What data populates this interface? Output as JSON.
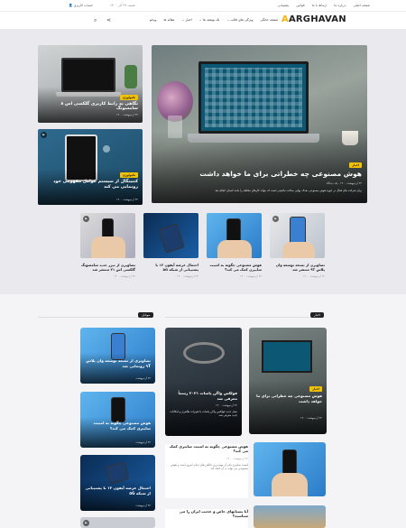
{
  "topbar": {
    "links": [
      "صفحه اصلی",
      "درباره ما",
      "ارتباط با ما",
      "قوانین",
      "پشتیبانی"
    ],
    "account": "حساب کاربری",
    "date": "شنبه، ۲۷ آذر ۱۴۰۰"
  },
  "nav": {
    "logo": "ARGHAVAN",
    "menu": [
      "صفحه خانگی",
      "ویژگی های قالب",
      "تک نوشته ها",
      "اخبار",
      "مقاله ها",
      "ویدئو"
    ]
  },
  "hero": {
    "badge": "اخبار",
    "title": "هوش مصنوعی چه خطراتی برای ما خواهد داشت",
    "meta": "۲۲ اردیبهشت ۱۴۰۰ - یک دیدگاه",
    "desc": "برای شرکت های فعال در حوزه هوش مصنوعی، هدف نهایی ساخت ماشینی است که بتواند کارهای مختلف را مانند انسان انجام دهد"
  },
  "side": [
    {
      "badge": "تکنولوژی",
      "title": "نگاهی به رابط کاربری گلکسی اس ۸ سامسونگ",
      "meta": "۲۲ اردیبهشت ۱۴۰۰"
    },
    {
      "badge": "تکنولوژی",
      "title": "کنتینگال از سیستم عوامل مفهومی خود رونمایی می کند",
      "meta": "۲۲ اردیبهشت ۱۴۰۰"
    }
  ],
  "cards": [
    {
      "title": "تصاویری از تیزر جدید سامسونگ گلکسی اس ۲۱ منتشر شد",
      "meta": "۲۲ اردیبهشت ۱۴۰۰"
    },
    {
      "title": "احتمال عرضه آیفون ۱۲ با پشتیبانی از شبکه ۵G",
      "meta": "۲۲ اردیبهشت ۱۴۰۰"
    },
    {
      "title": "هوش مصنوعی چگونه به امنیت سایبری کمک می کند؟",
      "meta": "۲۲ اردیبهشت ۱۴۰۰"
    },
    {
      "title": "تصاویری از نسخه توسعه وان پلاس ۹T منتشر شد",
      "meta": "۲۲ اردیبهشت ۱۴۰۰"
    }
  ],
  "sec2": {
    "right_head": "اخبار",
    "left_head": "موبایل",
    "big1": {
      "badge": "اخبار",
      "title": "هوش مصنوعی چه خطراتی برای ما خواهد داشت",
      "meta": "۲۲ اردیبهشت ۱۴۰۰"
    },
    "big2": {
      "title": "فولکس واگن پاسات ۲۰۲۱ رسماً معرفی شد",
      "meta": "۲۲ اردیبهشت ۱۴۰۰",
      "desc": "نسل جدید فولکس واگن پاسات با تغییرات ظاهری و امکانات جدید معرفی شد"
    },
    "txt1": {
      "title": "هوش مصنوعی چگونه به امنیت سایبری کمک می کند؟",
      "meta": "۲۲ اردیبهشت ۱۴۰۰",
      "desc": "امنیت سایبری یکی از مهم ترین چالش های دنیای امروز است و هوش مصنوعی می تواند به آن کمک کند"
    },
    "txt2": {
      "title": "آیا پستانهای خاص و عجیب ایران را می شناسید؟",
      "meta": "۲۲ اردیبهشت ۱۴۰۰"
    },
    "mob": [
      {
        "title": "تصاویری از نسخه توسعه وان پلاس ۹T رونمایی شد",
        "meta": "۲۲ اردیبهشت"
      },
      {
        "title": "هوش مصنوعی چگونه به امنیت سایبری کمک می کند؟",
        "meta": "۲۲ اردیبهشت"
      },
      {
        "title": "احتمال عرضه آیفون ۱۲ با پشتیبانی از شبکه ۵G",
        "meta": "۲۲ اردیبهشت"
      }
    ]
  }
}
